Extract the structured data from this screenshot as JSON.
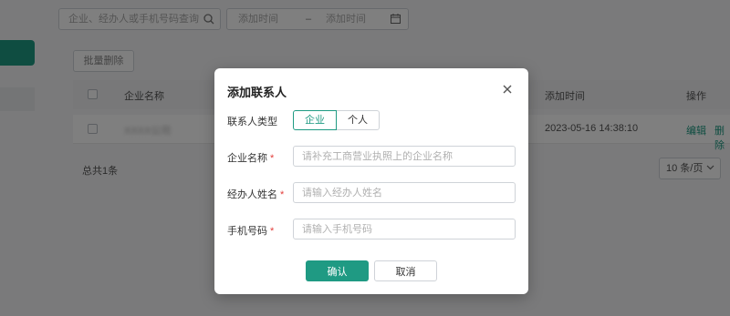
{
  "colors": {
    "accent": "#1f9a83",
    "required": "#e23c39"
  },
  "filters": {
    "search_placeholder": "企业、经办人或手机号码查询",
    "search_icon": "search-icon",
    "date_start_placeholder": "添加时间",
    "date_separator": "–",
    "date_end_placeholder": "添加时间",
    "calendar_icon": "calendar-icon"
  },
  "toolbar": {
    "batch_delete_label": "批量删除"
  },
  "table": {
    "columns": [
      "企业名称",
      "添加时间",
      "操作"
    ],
    "rows": [
      {
        "company": "XXXX公司",
        "added_time": "2023-05-16 14:38:10",
        "actions": [
          "编辑",
          "删除"
        ]
      }
    ]
  },
  "pagination": {
    "total_text": "总共1条",
    "page_size": "10 条/页"
  },
  "modal": {
    "title": "添加联系人",
    "close_icon": "close-icon",
    "contact_type_label": "联系人类型",
    "contact_type_options": [
      "企业",
      "个人"
    ],
    "contact_type_selected": "企业",
    "company_name_label": "企业名称",
    "company_name_placeholder": "请补充工商营业执照上的企业名称",
    "agent_name_label": "经办人姓名",
    "agent_name_placeholder": "请输入经办人姓名",
    "phone_label": "手机号码",
    "phone_placeholder": "请输入手机号码",
    "required_mark": "*",
    "confirm_label": "确认",
    "cancel_label": "取消"
  }
}
